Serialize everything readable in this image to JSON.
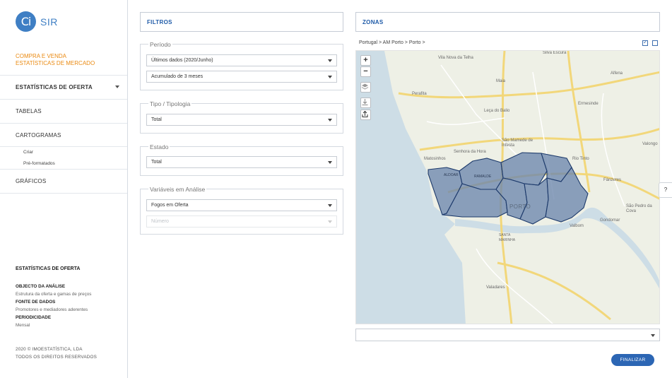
{
  "brand": {
    "logo_mark": "Ci",
    "name": "SIR"
  },
  "sidebar": {
    "section_line1": "COMPRA E VENDA",
    "section_line2": "ESTATÍSTICAS DE MERCADO",
    "nav": {
      "oferta": "ESTATÍSTICAS DE OFERTA",
      "tabelas": "TABELAS",
      "cartogramas": "CARTOGRAMAS",
      "criar": "Criar",
      "preformatados": "Pré-formatados",
      "graficos": "GRÁFICOS"
    },
    "info": {
      "title": "ESTATÍSTICAS DE OFERTA",
      "objecto_label": "OBJECTO DA ANÁLISE",
      "objecto_value": "Estrutura da oferta e gamas de preços",
      "fonte_label": "FONTE DE DADOS",
      "fonte_value": "Promotores e mediadores aderentes",
      "periodicidade_label": "PERIODICIDADE",
      "periodicidade_value": "Mensal"
    },
    "copyright_line1": "2020 © IMOESTATÍSTICA, LDA",
    "copyright_line2": "TODOS OS DIREITOS RESERVADOS"
  },
  "filtros": {
    "title": "FILTROS",
    "periodo": {
      "label": "Período",
      "value1": "Últimos dados (2020/Junho)",
      "value2": "Acumulado de 3 meses"
    },
    "tipo": {
      "label": "Tipo / Tipologia",
      "value": "Total"
    },
    "estado": {
      "label": "Estado",
      "value": "Total"
    },
    "variaveis": {
      "label": "Variáveis em Análise",
      "value": "Fogos em Oferta",
      "value2": "Número"
    }
  },
  "zonas": {
    "title": "ZONAS",
    "breadcrumb": "Portugal > AM Porto > Porto >",
    "finalize": "FINALIZAR",
    "help": "?"
  },
  "map": {
    "controls": {
      "zoom_in": "+",
      "zoom_out": "−"
    },
    "labels": {
      "vila_nova": "Vila Nova da Telha",
      "silva_escura": "Silva Escura",
      "alfena": "Alfena",
      "maia": "Maia",
      "perafita": "Perafita",
      "ermesinde": "Ermesinde",
      "leca": "Leça do Balio",
      "sao_mamede": "São Mamede de Infesta",
      "senhora": "Senhora da Hora",
      "matosinhos": "Matosinhos",
      "rio_tinto": "Rio Tinto",
      "valongo": "Valongo",
      "fanzeres": "Fânzeres",
      "porto": "PORTO",
      "sao_pedro": "São Pedro da Cova",
      "gondomar": "Gondomar",
      "valbom": "Valbom",
      "santa_marinha": "SANTA MARINHA",
      "valadares": "Valadares",
      "ramalde": "RAMALDE",
      "aldoar": "ALDOAR"
    },
    "colors": {
      "polygon_fill": "#6d87ad",
      "polygon_stroke": "#1d3a6b",
      "sea": "#cddde6",
      "land": "#eef0e6"
    }
  }
}
